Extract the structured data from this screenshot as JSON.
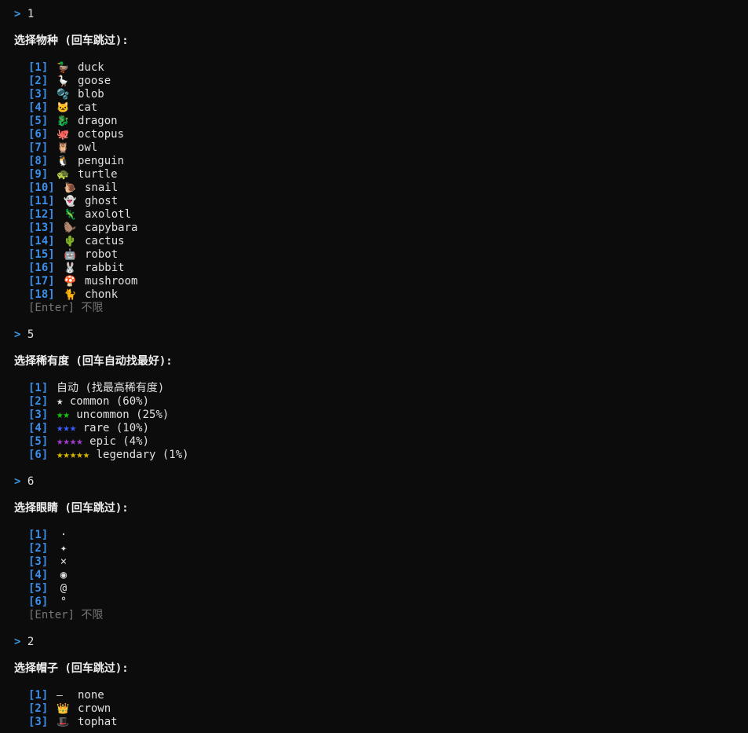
{
  "terminal": {
    "prompt_symbol": ">",
    "species": {
      "answer": "1",
      "heading": "选择物种 (回车跳过):",
      "items": [
        {
          "index": "[1]",
          "emoji": "🦆",
          "name": "duck"
        },
        {
          "index": "[2]",
          "emoji": "🪿",
          "name": "goose"
        },
        {
          "index": "[3]",
          "emoji": "🫧",
          "name": "blob"
        },
        {
          "index": "[4]",
          "emoji": "🐱",
          "name": "cat"
        },
        {
          "index": "[5]",
          "emoji": "🐉",
          "name": "dragon"
        },
        {
          "index": "[6]",
          "emoji": "🐙",
          "name": "octopus"
        },
        {
          "index": "[7]",
          "emoji": "🦉",
          "name": "owl"
        },
        {
          "index": "[8]",
          "emoji": "🐧",
          "name": "penguin"
        },
        {
          "index": "[9]",
          "emoji": "🐢",
          "name": "turtle"
        },
        {
          "index": "[10]",
          "emoji": "🐌",
          "name": "snail"
        },
        {
          "index": "[11]",
          "emoji": "👻",
          "name": "ghost"
        },
        {
          "index": "[12]",
          "emoji": "🦎",
          "name": "axolotl"
        },
        {
          "index": "[13]",
          "emoji": "🦫",
          "name": "capybara"
        },
        {
          "index": "[14]",
          "emoji": "🌵",
          "name": "cactus"
        },
        {
          "index": "[15]",
          "emoji": "🤖",
          "name": "robot"
        },
        {
          "index": "[16]",
          "emoji": "🐰",
          "name": "rabbit"
        },
        {
          "index": "[17]",
          "emoji": "🍄",
          "name": "mushroom"
        },
        {
          "index": "[18]",
          "emoji": "🐈",
          "name": "chonk"
        }
      ],
      "enter_option": "[Enter] 不限"
    },
    "rarity": {
      "answer": "5",
      "heading": "选择稀有度 (回车自动找最好):",
      "items": [
        {
          "index": "[1]",
          "stars": "",
          "name": "自动 (找最高稀有度)"
        },
        {
          "index": "[2]",
          "stars": "★",
          "name": "common (60%)"
        },
        {
          "index": "[3]",
          "stars": "★★",
          "name": "uncommon (25%)"
        },
        {
          "index": "[4]",
          "stars": "★★★",
          "name": "rare (10%)"
        },
        {
          "index": "[5]",
          "stars": "★★★★",
          "name": "epic (4%)"
        },
        {
          "index": "[6]",
          "stars": "★★★★★",
          "name": "legendary (1%)"
        }
      ],
      "colors": {
        "common": "#e6e6e6",
        "uncommon": "#16c60c",
        "rare": "#3b5bff",
        "epic": "#a33ad1",
        "legendary": "#d7b600"
      }
    },
    "eyes": {
      "answer": "6",
      "heading": "选择眼睛 (回车跳过):",
      "items": [
        {
          "index": "[1]",
          "glyph": "·"
        },
        {
          "index": "[2]",
          "glyph": "✦"
        },
        {
          "index": "[3]",
          "glyph": "×"
        },
        {
          "index": "[4]",
          "glyph": "◉"
        },
        {
          "index": "[5]",
          "glyph": "@"
        },
        {
          "index": "[6]",
          "glyph": "°"
        }
      ],
      "enter_option": "[Enter] 不限"
    },
    "hat": {
      "answer": "2",
      "heading": "选择帽子 (回车跳过):",
      "items": [
        {
          "index": "[1]",
          "emoji": "—",
          "name": "none"
        },
        {
          "index": "[2]",
          "emoji": "👑",
          "name": "crown"
        },
        {
          "index": "[3]",
          "emoji": "🎩",
          "name": "tophat"
        }
      ]
    }
  }
}
